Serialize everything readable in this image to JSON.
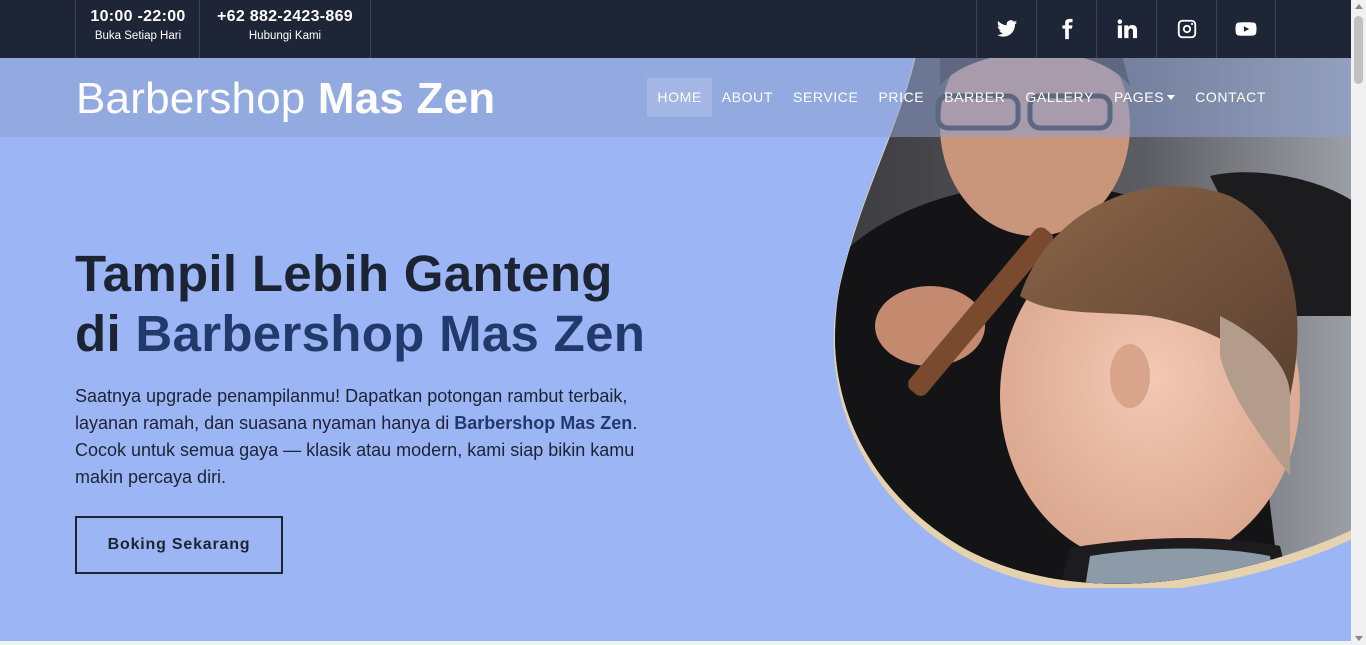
{
  "topbar": {
    "hours": {
      "main": "10:00 -22:00",
      "sub": "Buka Setiap Hari"
    },
    "phone": {
      "main": "+62 882-2423-869",
      "sub": "Hubungi Kami"
    },
    "socials": [
      {
        "icon": "twitter-icon"
      },
      {
        "icon": "facebook-icon"
      },
      {
        "icon": "linkedin-icon"
      },
      {
        "icon": "instagram-icon"
      },
      {
        "icon": "youtube-icon"
      }
    ]
  },
  "navbar": {
    "brand_regular": "Barbershop ",
    "brand_bold": "Mas Zen",
    "menu": [
      "HOME",
      "ABOUT",
      "SERVICE",
      "PRICE",
      "BARBER",
      "GALLERY",
      "PAGES",
      "CONTACT"
    ],
    "active": "HOME"
  },
  "hero": {
    "headline_line1": "Tampil Lebih Ganteng",
    "headline_line2_prefix": "di ",
    "headline_line2_highlight": "Barbershop Mas Zen",
    "desc_part1": "Saatnya upgrade penampilanmu! Dapatkan potongan rambut terbaik, layanan ramah, dan suasana nyaman hanya di ",
    "desc_bold": "Barbershop Mas Zen",
    "desc_part2": ". Cocok untuk semua gaya — klasik atau modern, kami siap bikin kamu makin percaya diri.",
    "cta": "Boking Sekarang"
  },
  "colors": {
    "topbar_bg": "#1e2536",
    "hero_bg": "#9cb5f4",
    "accent_text": "#22396b",
    "blob_border": "#e5d3b0"
  }
}
